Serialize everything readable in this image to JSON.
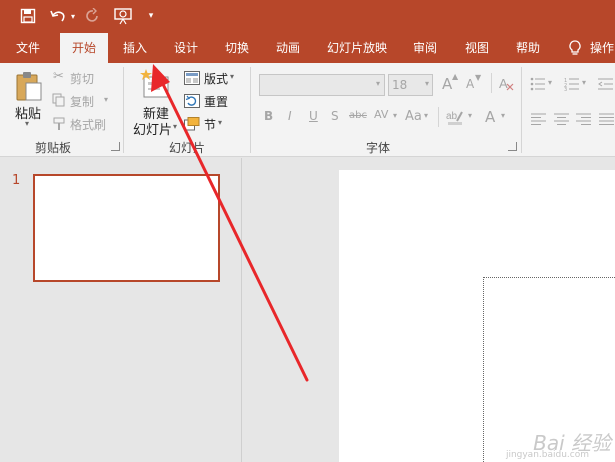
{
  "qat": {
    "save_icon": "save-icon",
    "undo_icon": "undo-icon",
    "redo_icon": "redo-icon",
    "slideshow_icon": "start-slideshow-icon",
    "customize_icon": "customize-qat-icon"
  },
  "tabs": [
    "文件",
    "开始",
    "插入",
    "设计",
    "切换",
    "动画",
    "幻灯片放映",
    "审阅",
    "视图",
    "帮助",
    "操作"
  ],
  "active_tab": "开始",
  "ribbon": {
    "clipboard": {
      "paste_label": "粘贴",
      "cut_label": "剪切",
      "copy_label": "复制",
      "format_painter_label": "格式刷",
      "group_label": "剪贴板"
    },
    "slides": {
      "new_slide_label_1": "新建",
      "new_slide_label_2": "幻灯片",
      "layout_label": "版式",
      "reset_label": "重置",
      "section_label": "节",
      "group_label": "幻灯片"
    },
    "font": {
      "font_name": "",
      "font_size": "18",
      "grow_font": "A",
      "shrink_font": "A",
      "bold": "B",
      "italic": "I",
      "underline": "U",
      "shadow": "S",
      "strikethrough": "abc",
      "spacing": "AV",
      "change_case": "Aa",
      "font_color": "A",
      "group_label": "字体"
    }
  },
  "thumbnails": [
    {
      "number": "1"
    }
  ],
  "watermark": {
    "brand": "Bai 经验",
    "url": "jingyan.baidu.com"
  },
  "colors": {
    "accent": "#b7472a",
    "annotation": "#e8272a"
  }
}
